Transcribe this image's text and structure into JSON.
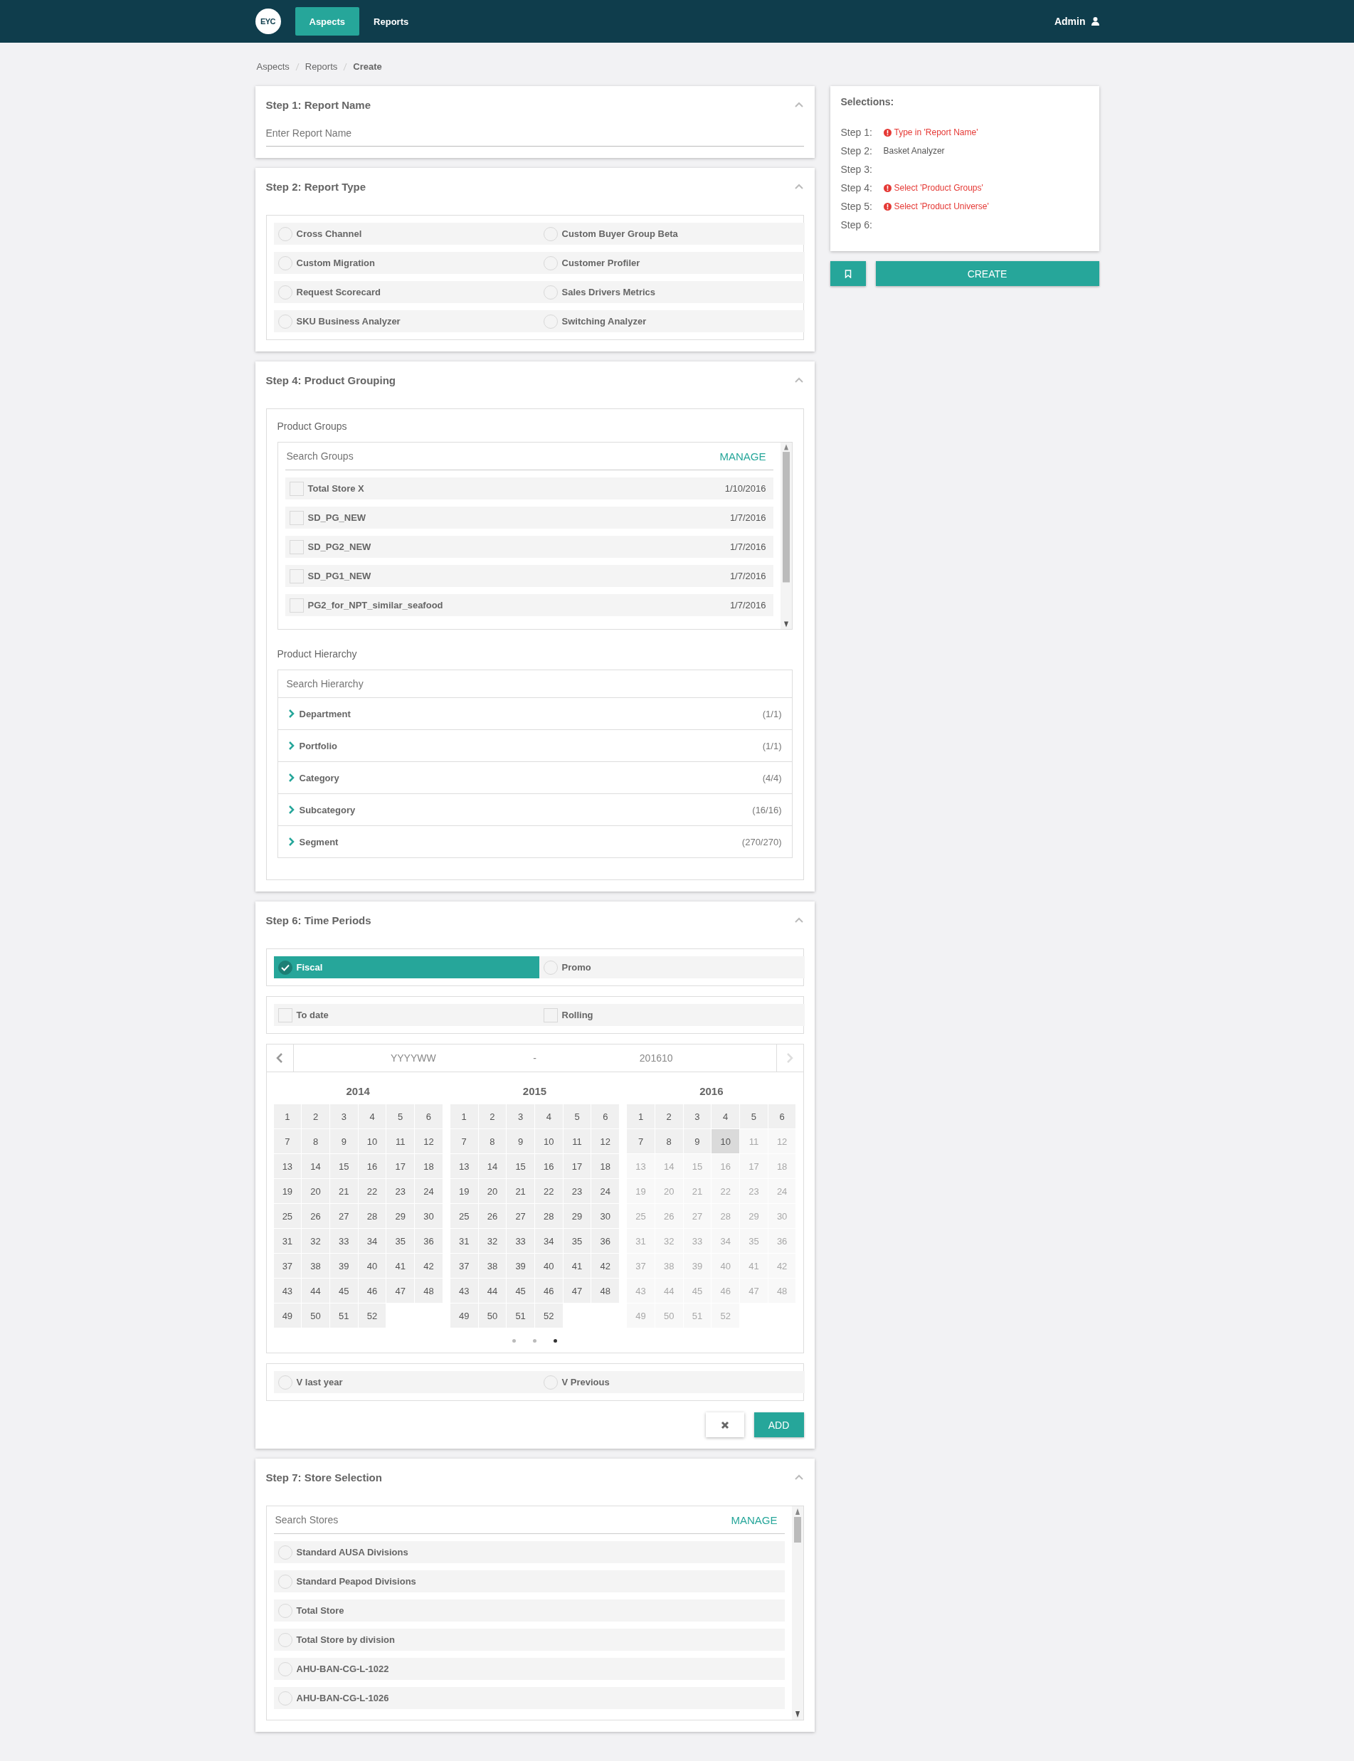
{
  "nav": {
    "logo": "EYC",
    "tabs": [
      {
        "label": "Aspects",
        "selected": true
      },
      {
        "label": "Reports",
        "selected": false
      }
    ],
    "user": "Admin"
  },
  "breadcrumb": [
    "Aspects",
    "Reports",
    "Create"
  ],
  "step1": {
    "title": "Step 1: Report Name",
    "expanded": true,
    "placeholder": "Enter Report Name"
  },
  "step2": {
    "title": "Step 2: Report Type",
    "expanded": true,
    "options": [
      {
        "label": "Cross Channel",
        "selected": false
      },
      {
        "label": "Custom Buyer Group Beta",
        "selected": false
      },
      {
        "label": "Custom Migration",
        "selected": false
      },
      {
        "label": "Customer Profiler",
        "selected": false
      },
      {
        "label": "Request Scorecard",
        "selected": false
      },
      {
        "label": "Sales Drivers Metrics",
        "selected": false
      },
      {
        "label": "SKU Business Analyzer",
        "selected": false
      },
      {
        "label": "Switching Analyzer",
        "selected": false
      }
    ]
  },
  "step4": {
    "title": "Step 4: Product Grouping",
    "expanded": true,
    "product_groups": {
      "title": "Product Groups",
      "placeholder": "Search Groups",
      "manage": "MANAGE",
      "items": [
        {
          "name": "Total Store X",
          "date": "1/10/2016",
          "checked": false
        },
        {
          "name": "SD_PG_NEW",
          "date": "1/7/2016",
          "checked": false
        },
        {
          "name": "SD_PG2_NEW",
          "date": "1/7/2016",
          "checked": false
        },
        {
          "name": "SD_PG1_NEW",
          "date": "1/7/2016",
          "checked": false
        },
        {
          "name": "PG2_for_NPT_similar_seafood",
          "date": "1/7/2016",
          "checked": false
        }
      ]
    },
    "product_hierarchy": {
      "title": "Product Hierarchy",
      "placeholder": "Search Hierarchy",
      "items": [
        {
          "label": "Department",
          "count": "(1/1)",
          "expanded": false
        },
        {
          "label": "Portfolio",
          "count": "(1/1)",
          "expanded": false
        },
        {
          "label": "Category",
          "count": "(4/4)",
          "expanded": false
        },
        {
          "label": "Subcategory",
          "count": "(16/16)",
          "expanded": false
        },
        {
          "label": "Segment",
          "count": "(270/270)",
          "expanded": false
        }
      ]
    }
  },
  "step6": {
    "title": "Step 6: Time Periods",
    "expanded": true,
    "calendar_types": [
      {
        "label": "Fiscal",
        "selected": true
      },
      {
        "label": "Promo",
        "selected": false
      }
    ],
    "modes": [
      {
        "label": "To date",
        "checked": false
      },
      {
        "label": "Rolling",
        "checked": false
      }
    ],
    "range": {
      "start_placeholder": "YYYYWW",
      "separator": "-",
      "end": "201610"
    },
    "years": [
      {
        "year": "2014",
        "weeks": [
          {
            "label": "1",
            "disabled": false,
            "selected": false
          },
          {
            "label": "2",
            "disabled": false,
            "selected": false
          },
          {
            "label": "3",
            "disabled": false,
            "selected": false
          },
          {
            "label": "4",
            "disabled": false,
            "selected": false
          },
          {
            "label": "5",
            "disabled": false,
            "selected": false
          },
          {
            "label": "6",
            "disabled": false,
            "selected": false
          },
          {
            "label": "7",
            "disabled": false,
            "selected": false
          },
          {
            "label": "8",
            "disabled": false,
            "selected": false
          },
          {
            "label": "9",
            "disabled": false,
            "selected": false
          },
          {
            "label": "10",
            "disabled": false,
            "selected": false
          },
          {
            "label": "11",
            "disabled": false,
            "selected": false
          },
          {
            "label": "12",
            "disabled": false,
            "selected": false
          },
          {
            "label": "13",
            "disabled": false,
            "selected": false
          },
          {
            "label": "14",
            "disabled": false,
            "selected": false
          },
          {
            "label": "15",
            "disabled": false,
            "selected": false
          },
          {
            "label": "16",
            "disabled": false,
            "selected": false
          },
          {
            "label": "17",
            "disabled": false,
            "selected": false
          },
          {
            "label": "18",
            "disabled": false,
            "selected": false
          },
          {
            "label": "19",
            "disabled": false,
            "selected": false
          },
          {
            "label": "20",
            "disabled": false,
            "selected": false
          },
          {
            "label": "21",
            "disabled": false,
            "selected": false
          },
          {
            "label": "22",
            "disabled": false,
            "selected": false
          },
          {
            "label": "23",
            "disabled": false,
            "selected": false
          },
          {
            "label": "24",
            "disabled": false,
            "selected": false
          },
          {
            "label": "25",
            "disabled": false,
            "selected": false
          },
          {
            "label": "26",
            "disabled": false,
            "selected": false
          },
          {
            "label": "27",
            "disabled": false,
            "selected": false
          },
          {
            "label": "28",
            "disabled": false,
            "selected": false
          },
          {
            "label": "29",
            "disabled": false,
            "selected": false
          },
          {
            "label": "30",
            "disabled": false,
            "selected": false
          },
          {
            "label": "31",
            "disabled": false,
            "selected": false
          },
          {
            "label": "32",
            "disabled": false,
            "selected": false
          },
          {
            "label": "33",
            "disabled": false,
            "selected": false
          },
          {
            "label": "34",
            "disabled": false,
            "selected": false
          },
          {
            "label": "35",
            "disabled": false,
            "selected": false
          },
          {
            "label": "36",
            "disabled": false,
            "selected": false
          },
          {
            "label": "37",
            "disabled": false,
            "selected": false
          },
          {
            "label": "38",
            "disabled": false,
            "selected": false
          },
          {
            "label": "39",
            "disabled": false,
            "selected": false
          },
          {
            "label": "40",
            "disabled": false,
            "selected": false
          },
          {
            "label": "41",
            "disabled": false,
            "selected": false
          },
          {
            "label": "42",
            "disabled": false,
            "selected": false
          },
          {
            "label": "43",
            "disabled": false,
            "selected": false
          },
          {
            "label": "44",
            "disabled": false,
            "selected": false
          },
          {
            "label": "45",
            "disabled": false,
            "selected": false
          },
          {
            "label": "46",
            "disabled": false,
            "selected": false
          },
          {
            "label": "47",
            "disabled": false,
            "selected": false
          },
          {
            "label": "48",
            "disabled": false,
            "selected": false
          },
          {
            "label": "49",
            "disabled": false,
            "selected": false
          },
          {
            "label": "50",
            "disabled": false,
            "selected": false
          },
          {
            "label": "51",
            "disabled": false,
            "selected": false
          },
          {
            "label": "52",
            "disabled": false,
            "selected": false
          }
        ]
      },
      {
        "year": "2015",
        "weeks": [
          {
            "label": "1",
            "disabled": false,
            "selected": false
          },
          {
            "label": "2",
            "disabled": false,
            "selected": false
          },
          {
            "label": "3",
            "disabled": false,
            "selected": false
          },
          {
            "label": "4",
            "disabled": false,
            "selected": false
          },
          {
            "label": "5",
            "disabled": false,
            "selected": false
          },
          {
            "label": "6",
            "disabled": false,
            "selected": false
          },
          {
            "label": "7",
            "disabled": false,
            "selected": false
          },
          {
            "label": "8",
            "disabled": false,
            "selected": false
          },
          {
            "label": "9",
            "disabled": false,
            "selected": false
          },
          {
            "label": "10",
            "disabled": false,
            "selected": false
          },
          {
            "label": "11",
            "disabled": false,
            "selected": false
          },
          {
            "label": "12",
            "disabled": false,
            "selected": false
          },
          {
            "label": "13",
            "disabled": false,
            "selected": false
          },
          {
            "label": "14",
            "disabled": false,
            "selected": false
          },
          {
            "label": "15",
            "disabled": false,
            "selected": false
          },
          {
            "label": "16",
            "disabled": false,
            "selected": false
          },
          {
            "label": "17",
            "disabled": false,
            "selected": false
          },
          {
            "label": "18",
            "disabled": false,
            "selected": false
          },
          {
            "label": "19",
            "disabled": false,
            "selected": false
          },
          {
            "label": "20",
            "disabled": false,
            "selected": false
          },
          {
            "label": "21",
            "disabled": false,
            "selected": false
          },
          {
            "label": "22",
            "disabled": false,
            "selected": false
          },
          {
            "label": "23",
            "disabled": false,
            "selected": false
          },
          {
            "label": "24",
            "disabled": false,
            "selected": false
          },
          {
            "label": "25",
            "disabled": false,
            "selected": false
          },
          {
            "label": "26",
            "disabled": false,
            "selected": false
          },
          {
            "label": "27",
            "disabled": false,
            "selected": false
          },
          {
            "label": "28",
            "disabled": false,
            "selected": false
          },
          {
            "label": "29",
            "disabled": false,
            "selected": false
          },
          {
            "label": "30",
            "disabled": false,
            "selected": false
          },
          {
            "label": "31",
            "disabled": false,
            "selected": false
          },
          {
            "label": "32",
            "disabled": false,
            "selected": false
          },
          {
            "label": "33",
            "disabled": false,
            "selected": false
          },
          {
            "label": "34",
            "disabled": false,
            "selected": false
          },
          {
            "label": "35",
            "disabled": false,
            "selected": false
          },
          {
            "label": "36",
            "disabled": false,
            "selected": false
          },
          {
            "label": "37",
            "disabled": false,
            "selected": false
          },
          {
            "label": "38",
            "disabled": false,
            "selected": false
          },
          {
            "label": "39",
            "disabled": false,
            "selected": false
          },
          {
            "label": "40",
            "disabled": false,
            "selected": false
          },
          {
            "label": "41",
            "disabled": false,
            "selected": false
          },
          {
            "label": "42",
            "disabled": false,
            "selected": false
          },
          {
            "label": "43",
            "disabled": false,
            "selected": false
          },
          {
            "label": "44",
            "disabled": false,
            "selected": false
          },
          {
            "label": "45",
            "disabled": false,
            "selected": false
          },
          {
            "label": "46",
            "disabled": false,
            "selected": false
          },
          {
            "label": "47",
            "disabled": false,
            "selected": false
          },
          {
            "label": "48",
            "disabled": false,
            "selected": false
          },
          {
            "label": "49",
            "disabled": false,
            "selected": false
          },
          {
            "label": "50",
            "disabled": false,
            "selected": false
          },
          {
            "label": "51",
            "disabled": false,
            "selected": false
          },
          {
            "label": "52",
            "disabled": false,
            "selected": false
          }
        ]
      },
      {
        "year": "2016",
        "weeks": [
          {
            "label": "1",
            "disabled": false,
            "selected": false
          },
          {
            "label": "2",
            "disabled": false,
            "selected": false
          },
          {
            "label": "3",
            "disabled": false,
            "selected": false
          },
          {
            "label": "4",
            "disabled": false,
            "selected": false
          },
          {
            "label": "5",
            "disabled": false,
            "selected": false
          },
          {
            "label": "6",
            "disabled": false,
            "selected": false
          },
          {
            "label": "7",
            "disabled": false,
            "selected": false
          },
          {
            "label": "8",
            "disabled": false,
            "selected": false
          },
          {
            "label": "9",
            "disabled": false,
            "selected": false
          },
          {
            "label": "10",
            "disabled": false,
            "selected": true
          },
          {
            "label": "11",
            "disabled": true,
            "selected": false
          },
          {
            "label": "12",
            "disabled": true,
            "selected": false
          },
          {
            "label": "13",
            "disabled": true,
            "selected": false
          },
          {
            "label": "14",
            "disabled": true,
            "selected": false
          },
          {
            "label": "15",
            "disabled": true,
            "selected": false
          },
          {
            "label": "16",
            "disabled": true,
            "selected": false
          },
          {
            "label": "17",
            "disabled": true,
            "selected": false
          },
          {
            "label": "18",
            "disabled": true,
            "selected": false
          },
          {
            "label": "19",
            "disabled": true,
            "selected": false
          },
          {
            "label": "20",
            "disabled": true,
            "selected": false
          },
          {
            "label": "21",
            "disabled": true,
            "selected": false
          },
          {
            "label": "22",
            "disabled": true,
            "selected": false
          },
          {
            "label": "23",
            "disabled": true,
            "selected": false
          },
          {
            "label": "24",
            "disabled": true,
            "selected": false
          },
          {
            "label": "25",
            "disabled": true,
            "selected": false
          },
          {
            "label": "26",
            "disabled": true,
            "selected": false
          },
          {
            "label": "27",
            "disabled": true,
            "selected": false
          },
          {
            "label": "28",
            "disabled": true,
            "selected": false
          },
          {
            "label": "29",
            "disabled": true,
            "selected": false
          },
          {
            "label": "30",
            "disabled": true,
            "selected": false
          },
          {
            "label": "31",
            "disabled": true,
            "selected": false
          },
          {
            "label": "32",
            "disabled": true,
            "selected": false
          },
          {
            "label": "33",
            "disabled": true,
            "selected": false
          },
          {
            "label": "34",
            "disabled": true,
            "selected": false
          },
          {
            "label": "35",
            "disabled": true,
            "selected": false
          },
          {
            "label": "36",
            "disabled": true,
            "selected": false
          },
          {
            "label": "37",
            "disabled": true,
            "selected": false
          },
          {
            "label": "38",
            "disabled": true,
            "selected": false
          },
          {
            "label": "39",
            "disabled": true,
            "selected": false
          },
          {
            "label": "40",
            "disabled": true,
            "selected": false
          },
          {
            "label": "41",
            "disabled": true,
            "selected": false
          },
          {
            "label": "42",
            "disabled": true,
            "selected": false
          },
          {
            "label": "43",
            "disabled": true,
            "selected": false
          },
          {
            "label": "44",
            "disabled": true,
            "selected": false
          },
          {
            "label": "45",
            "disabled": true,
            "selected": false
          },
          {
            "label": "46",
            "disabled": true,
            "selected": false
          },
          {
            "label": "47",
            "disabled": true,
            "selected": false
          },
          {
            "label": "48",
            "disabled": true,
            "selected": false
          },
          {
            "label": "49",
            "disabled": true,
            "selected": false
          },
          {
            "label": "50",
            "disabled": true,
            "selected": false
          },
          {
            "label": "51",
            "disabled": true,
            "selected": false
          },
          {
            "label": "52",
            "disabled": true,
            "selected": false
          }
        ]
      }
    ],
    "pager": [
      {
        "selected": false
      },
      {
        "selected": false
      },
      {
        "selected": true
      }
    ],
    "comparisons": [
      {
        "label": "V last year",
        "selected": false
      },
      {
        "label": "V Previous",
        "selected": false
      }
    ],
    "add": "ADD"
  },
  "step7": {
    "title": "Step 7: Store Selection",
    "expanded": true,
    "placeholder": "Search Stores",
    "manage": "MANAGE",
    "stores": [
      {
        "label": "Standard AUSA Divisions",
        "selected": false
      },
      {
        "label": "Standard Peapod Divisions",
        "selected": false
      },
      {
        "label": "Total Store",
        "selected": false
      },
      {
        "label": "Total Store by division",
        "selected": false
      },
      {
        "label": "AHU-BAN-CG-L-1022",
        "selected": false
      },
      {
        "label": "AHU-BAN-CG-L-1026",
        "selected": false
      }
    ]
  },
  "selections": {
    "title": "Selections:",
    "rows": [
      {
        "step": "Step 1:",
        "kind": "error",
        "text": "Type in 'Report Name'"
      },
      {
        "step": "Step 2:",
        "kind": "value",
        "text": "Basket Analyzer"
      },
      {
        "step": "Step 3:",
        "kind": "empty"
      },
      {
        "step": "Step 4:",
        "kind": "error",
        "text": "Select 'Product Groups'"
      },
      {
        "step": "Step 5:",
        "kind": "error",
        "text": "Select 'Product Universe'"
      },
      {
        "step": "Step 6:",
        "kind": "empty"
      }
    ]
  },
  "create": "CREATE"
}
